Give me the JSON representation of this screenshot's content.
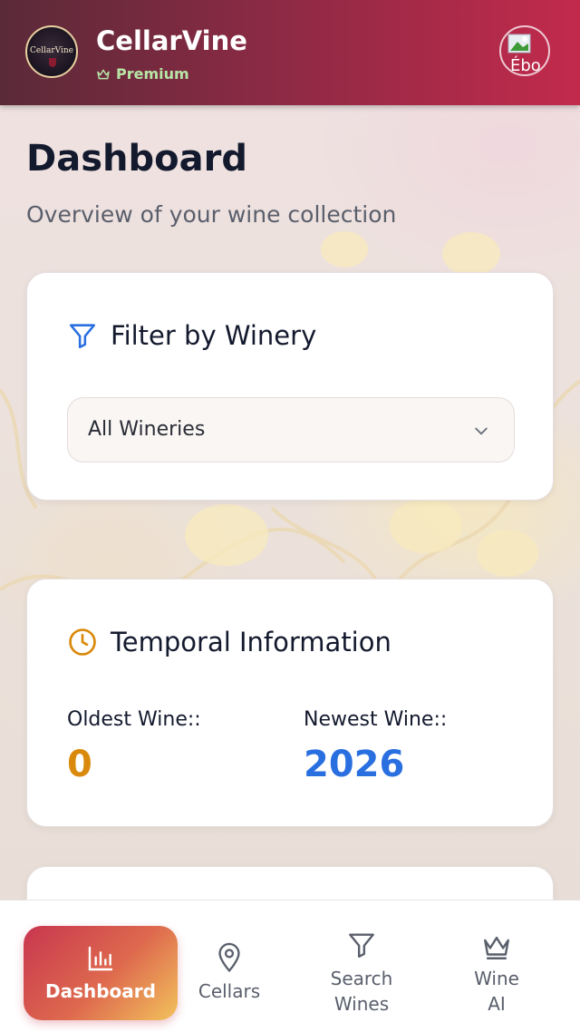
{
  "header": {
    "app_name": "CellarVine",
    "logo_text": "CellarVine",
    "plan_badge": "Premium",
    "avatar_alt": "Ébo"
  },
  "page": {
    "title": "Dashboard",
    "subtitle": "Overview of your wine collection"
  },
  "filter_card": {
    "title": "Filter by Winery",
    "select_value": "All Wineries"
  },
  "temporal_card": {
    "title": "Temporal Information",
    "oldest_label": "Oldest Wine::",
    "oldest_value": "0",
    "newest_label": "Newest Wine::",
    "newest_value": "2026"
  },
  "bottom_nav": {
    "dashboard": "Dashboard",
    "cellars": "Cellars",
    "search": "Search Wines",
    "search_line1": "Search",
    "search_line2": "Wines",
    "wine_ai_line1": "Wine",
    "wine_ai_line2": "AI"
  },
  "colors": {
    "header_start": "#5a2a38",
    "header_end": "#c22a4c",
    "premium": "#b8e6a6",
    "oldest_accent": "#d98a0c",
    "newest_accent": "#2a6fe0",
    "filter_icon": "#2a6fe0"
  },
  "icons": {
    "premium": "crown-icon",
    "filter": "filter-icon",
    "temporal": "clock-icon",
    "select": "chevron-down-icon",
    "dashboard": "bar-chart-icon",
    "cellars": "map-pin-icon",
    "search": "filter-icon",
    "wine_ai": "crown-icon"
  }
}
